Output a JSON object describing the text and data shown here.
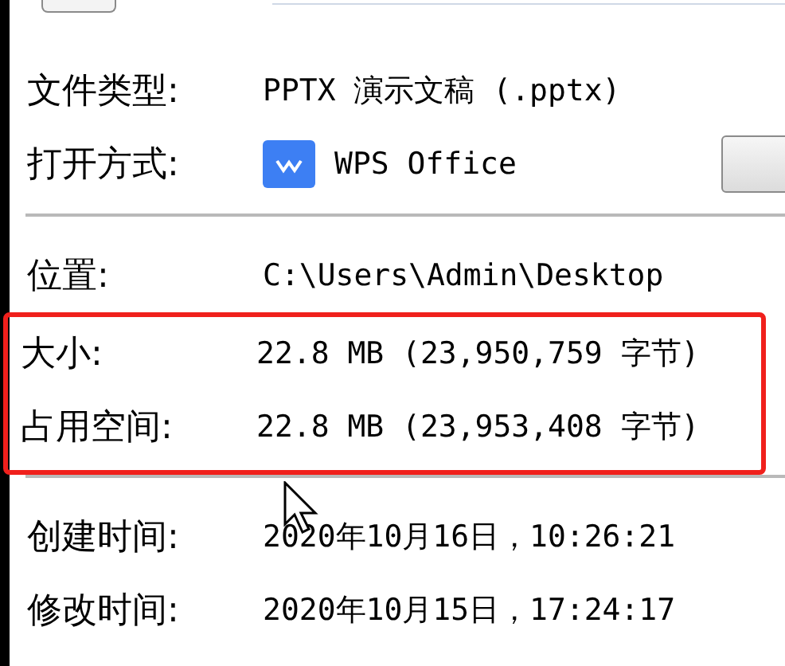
{
  "sections": [
    {
      "highlighted": false,
      "rows": [
        {
          "kind": "text",
          "label": "文件类型:",
          "value": "PPTX 演示文稿 (.pptx)"
        },
        {
          "kind": "app",
          "label": "打开方式:",
          "value": "WPS Office"
        }
      ]
    },
    {
      "highlighted": false,
      "rows": [
        {
          "kind": "text",
          "label": "位置:",
          "value": "C:\\Users\\Admin\\Desktop"
        }
      ]
    },
    {
      "highlighted": true,
      "rows": [
        {
          "kind": "text",
          "label": "大小:",
          "value": "22.8 MB (23,950,759 字节)"
        },
        {
          "kind": "text",
          "label": "占用空间:",
          "value": "22.8 MB (23,953,408 字节)"
        }
      ]
    },
    {
      "highlighted": false,
      "rows": [
        {
          "kind": "text",
          "label": "创建时间:",
          "value": "2020年10月16日，10:26:21"
        },
        {
          "kind": "text",
          "label": "修改时间:",
          "value": "2020年10月15日，17:24:17"
        }
      ]
    }
  ]
}
